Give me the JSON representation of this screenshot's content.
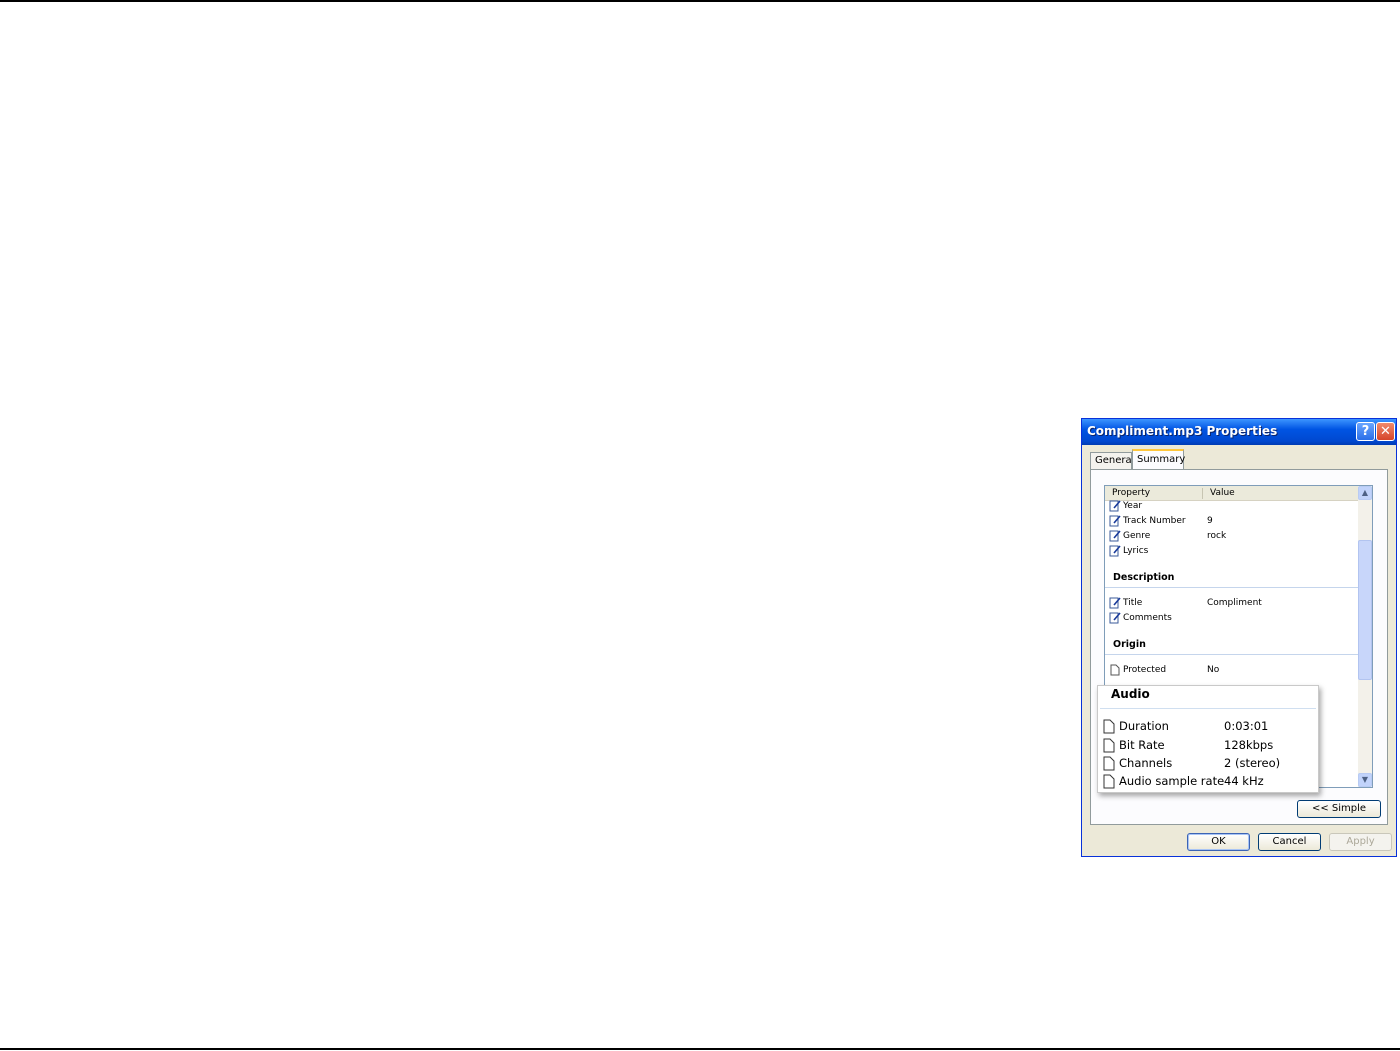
{
  "dialog": {
    "title": "Compliment.mp3 Properties",
    "help_glyph": "?",
    "close_glyph": "✕",
    "tabs": [
      {
        "label": "General"
      },
      {
        "label": "Summary"
      }
    ],
    "list": {
      "header": {
        "property": "Property",
        "value": "Value"
      },
      "rows_top": [
        {
          "name": "Year",
          "value": "",
          "icon": "edit-document-icon"
        },
        {
          "name": "Track Number",
          "value": "9",
          "icon": "edit-document-icon"
        },
        {
          "name": "Genre",
          "value": "rock",
          "icon": "edit-document-icon"
        },
        {
          "name": "Lyrics",
          "value": "",
          "icon": "edit-document-icon"
        }
      ],
      "group_description": "Description",
      "rows_description": [
        {
          "name": "Title",
          "value": "Compliment",
          "icon": "edit-document-icon"
        },
        {
          "name": "Comments",
          "value": "",
          "icon": "edit-document-icon"
        }
      ],
      "group_origin": "Origin",
      "rows_origin": [
        {
          "name": "Protected",
          "value": "No",
          "icon": "document-icon"
        }
      ],
      "scroll_up_glyph": "▲",
      "scroll_down_glyph": "▼"
    },
    "simple_button": "<< Simple",
    "ok_button": "OK",
    "cancel_button": "Cancel",
    "apply_button": "Apply"
  },
  "callout": {
    "title": "Audio",
    "rows": [
      {
        "name": "Duration",
        "value": "0:03:01",
        "icon": "document-icon"
      },
      {
        "name": "Bit Rate",
        "value": "128kbps",
        "icon": "document-icon"
      },
      {
        "name": "Channels",
        "value": "2 (stereo)",
        "icon": "document-icon"
      },
      {
        "name": "Audio sample rate",
        "value": "44 kHz",
        "icon": "document-icon"
      }
    ]
  },
  "colors": {
    "titlebar": "#0054e3",
    "dialog_face": "#ece9d8",
    "tab_highlight": "#ffc73c"
  }
}
